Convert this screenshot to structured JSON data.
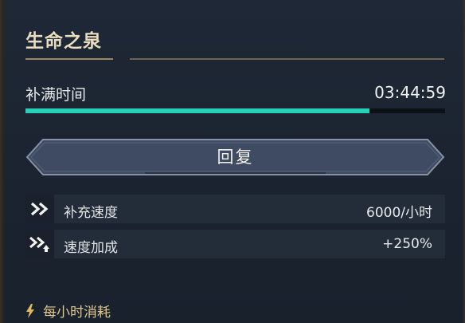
{
  "panel": {
    "title": "生命之泉"
  },
  "refill": {
    "label": "补满时间",
    "time": "03:44:59",
    "progress": 0.82
  },
  "restore_button": {
    "label": "回复"
  },
  "stats": [
    {
      "icon": "double-chevron-icon",
      "label": "补充速度",
      "value": "6000/小时"
    },
    {
      "icon": "speed-boost-icon",
      "label": "速度加成",
      "value": "+250%"
    }
  ],
  "hourly_cost": {
    "icon": "lightning-icon",
    "label": "每小时消耗"
  },
  "colors": {
    "title": "#e9dcbf",
    "progress": "#27d0b8",
    "accent_gold": "#e0c78e",
    "button_fill": "#3e4b62",
    "button_border": "#8592a6"
  }
}
